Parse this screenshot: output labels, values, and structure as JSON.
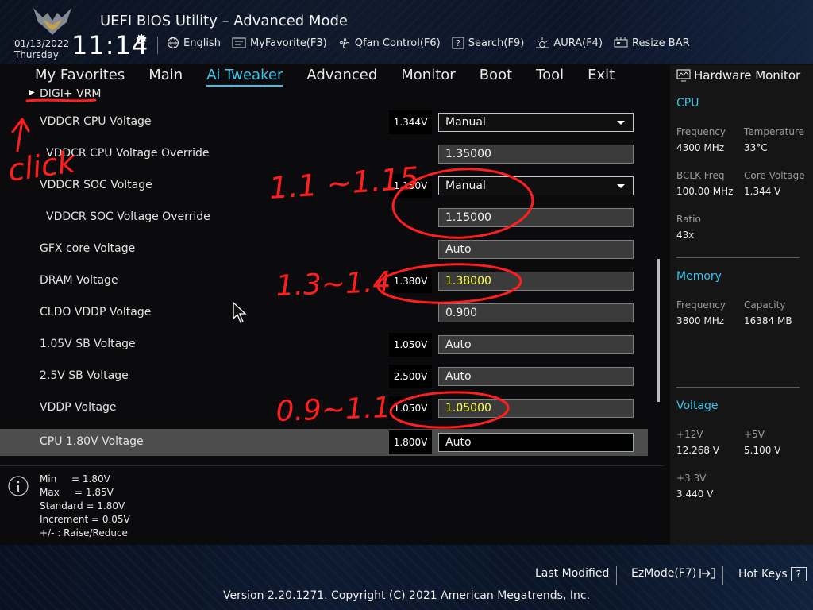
{
  "header": {
    "title": "UEFI BIOS Utility – Advanced Mode",
    "date": "01/13/2022",
    "weekday": "Thursday",
    "time": "11:14",
    "toolbar": [
      {
        "label": "English",
        "icon": "globe-icon"
      },
      {
        "label": "MyFavorite(F3)",
        "icon": "favorite-icon"
      },
      {
        "label": "Qfan Control(F6)",
        "icon": "fan-icon"
      },
      {
        "label": "Search(F9)",
        "icon": "search-icon"
      },
      {
        "label": "AURA(F4)",
        "icon": "aura-icon"
      },
      {
        "label": "Resize BAR",
        "icon": "resize-bar-icon"
      }
    ]
  },
  "nav": {
    "tabs": [
      "My Favorites",
      "Main",
      "Ai Tweaker",
      "Advanced",
      "Monitor",
      "Boot",
      "Tool",
      "Exit"
    ],
    "active": "Ai Tweaker"
  },
  "settings": {
    "submenu": "DIGI+ VRM",
    "rows": [
      {
        "label": "VDDCR CPU Voltage",
        "current": "1.344V",
        "value": "Manual"
      },
      {
        "label": "VDDCR CPU Voltage Override",
        "value": "1.35000"
      },
      {
        "label": "VDDCR SOC Voltage",
        "current": "1.150V",
        "value": "Manual"
      },
      {
        "label": "VDDCR SOC Voltage Override",
        "value": "1.15000"
      },
      {
        "label": "GFX core Voltage",
        "value": "Auto"
      },
      {
        "label": "DRAM Voltage",
        "current": "1.380V",
        "value": "1.38000"
      },
      {
        "label": "CLDO VDDP Voltage",
        "value": "0.900"
      },
      {
        "label": "1.05V SB Voltage",
        "current": "1.050V",
        "value": "Auto"
      },
      {
        "label": "2.5V SB Voltage",
        "current": "2.500V",
        "value": "Auto"
      },
      {
        "label": "VDDP Voltage",
        "current": "1.050V",
        "value": "1.05000"
      },
      {
        "label": "CPU 1.80V Voltage",
        "current": "1.800V",
        "value": "Auto"
      }
    ]
  },
  "help": {
    "min_label": "Min",
    "min_value": "= 1.80V",
    "max_label": "Max",
    "max_value": "= 1.85V",
    "standard": "Standard  = 1.80V",
    "increment": "Increment = 0.05V",
    "keys": "+/- : Raise/Reduce"
  },
  "hardware_monitor": {
    "title": "Hardware Monitor",
    "cpu": {
      "heading": "CPU",
      "frequency_label": "Frequency",
      "frequency": "4300 MHz",
      "temperature_label": "Temperature",
      "temperature": "33°C",
      "bclk_label": "BCLK Freq",
      "bclk": "100.00 MHz",
      "core_voltage_label": "Core Voltage",
      "core_voltage": "1.344 V",
      "ratio_label": "Ratio",
      "ratio": "43x"
    },
    "memory": {
      "heading": "Memory",
      "frequency_label": "Frequency",
      "frequency": "3800 MHz",
      "capacity_label": "Capacity",
      "capacity": "16384 MB"
    },
    "voltage": {
      "heading": "Voltage",
      "v12_label": "+12V",
      "v12": "12.268 V",
      "v5_label": "+5V",
      "v5": "5.100 V",
      "v33_label": "+3.3V",
      "v33": "3.440 V"
    }
  },
  "footer": {
    "last_modified": "Last Modified",
    "ezmode": "EzMode(F7)",
    "hot_keys": "Hot Keys",
    "hot_keys_key": "?",
    "copyright": "Version 2.20.1271. Copyright (C) 2021 American Megatrends, Inc."
  },
  "annotations": {
    "click_note": "click",
    "soc_range": "1.1 ~1.15",
    "dram_range": "1.3~1.4",
    "vddp_range": "0.9~1.1",
    "ink_color": "#ff1e1e"
  },
  "colors": {
    "accent": "#36c6ee",
    "highlight_value": "#ffff44",
    "background": "#0b0b0d"
  }
}
